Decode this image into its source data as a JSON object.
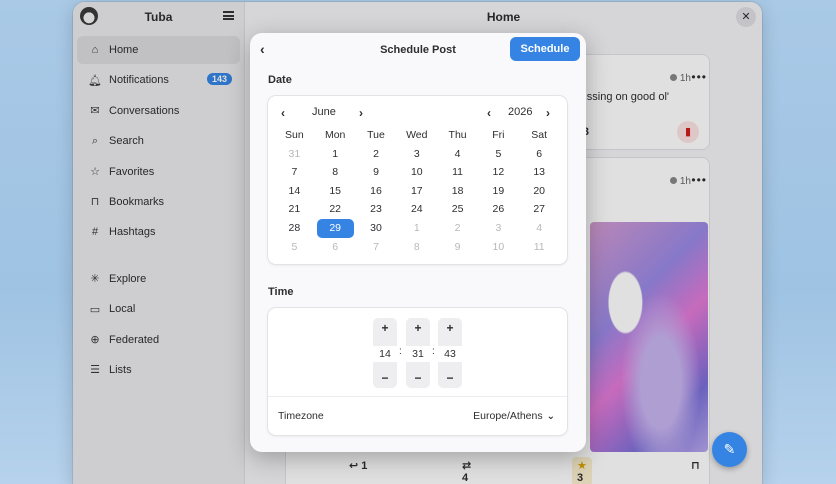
{
  "sidebar": {
    "app_title": "Tuba",
    "items": [
      {
        "label": "Home",
        "icon": "home-icon",
        "glyph": "⌂"
      },
      {
        "label": "Notifications",
        "icon": "bell-icon",
        "glyph": "🔔︎",
        "badge": "143"
      },
      {
        "label": "Conversations",
        "icon": "mail-icon",
        "glyph": "✉"
      },
      {
        "label": "Search",
        "icon": "search-icon",
        "glyph": "⌕"
      },
      {
        "label": "Favorites",
        "icon": "star-icon",
        "glyph": "☆"
      },
      {
        "label": "Bookmarks",
        "icon": "bookmark-icon",
        "glyph": "⊓"
      },
      {
        "label": "Hashtags",
        "icon": "hash-icon",
        "glyph": "#"
      },
      {
        "label": "Explore",
        "icon": "explore-icon",
        "glyph": "✳"
      },
      {
        "label": "Local",
        "icon": "local-icon",
        "glyph": "▭"
      },
      {
        "label": "Federated",
        "icon": "globe-icon",
        "glyph": "⊕"
      },
      {
        "label": "Lists",
        "icon": "list-icon",
        "glyph": "☰"
      }
    ]
  },
  "content": {
    "title": "Home",
    "post1": {
      "time": "1h",
      "text": "ssing on good ol'",
      "boosts": "3"
    },
    "post2": {
      "time": "1h",
      "replies": "1",
      "boosts": "4",
      "favorites": "3"
    }
  },
  "dialog": {
    "title": "Schedule Post",
    "schedule_label": "Schedule",
    "date_label": "Date",
    "time_label": "Time",
    "month": "June",
    "year": "2026",
    "weekdays": [
      "Sun",
      "Mon",
      "Tue",
      "Wed",
      "Thu",
      "Fri",
      "Sat"
    ],
    "days": [
      [
        "31",
        "1",
        "2",
        "3",
        "4",
        "5",
        "6"
      ],
      [
        "7",
        "8",
        "9",
        "10",
        "11",
        "12",
        "13"
      ],
      [
        "14",
        "15",
        "16",
        "17",
        "18",
        "19",
        "20"
      ],
      [
        "21",
        "22",
        "23",
        "24",
        "25",
        "26",
        "27"
      ],
      [
        "28",
        "29",
        "30",
        "1",
        "2",
        "3",
        "4"
      ],
      [
        "5",
        "6",
        "7",
        "8",
        "9",
        "10",
        "11"
      ]
    ],
    "selected_day": "29",
    "hour": "14",
    "minute": "31",
    "second": "43",
    "timezone_label": "Timezone",
    "timezone_value": "Europe/Athens"
  },
  "colors": {
    "accent": "#3584e4",
    "bookmark_red": "#d21e1e"
  }
}
